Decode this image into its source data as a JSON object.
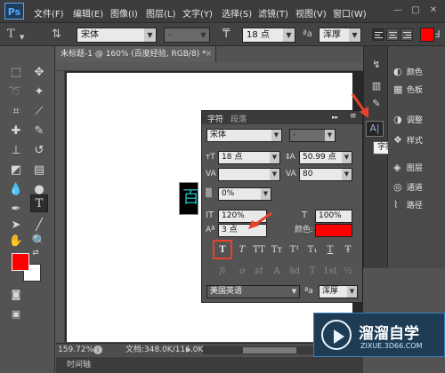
{
  "app": {
    "logo_text": "Ps",
    "menus": [
      "文件(F)",
      "编辑(E)",
      "图像(I)",
      "图层(L)",
      "文字(Y)",
      "选择(S)",
      "滤镜(T)",
      "视图(V)",
      "窗口(W)"
    ],
    "window_controls": [
      "—",
      "□",
      "✕"
    ]
  },
  "options_bar": {
    "font_family": "宋体",
    "font_style": "-",
    "font_size": "18 点",
    "anti_alias_label": "ªa",
    "anti_alias": "浑厚"
  },
  "document": {
    "tab_title": "未标题-1 @ 160% (百度经验, RGB/8) *",
    "zoom": "159.72%",
    "doc_info": "文档:348.0K/116.0K",
    "timeline": "时间轴",
    "text_glyph": "百"
  },
  "char_panel": {
    "tabs": [
      "字符",
      "段落"
    ],
    "font_family": "宋体",
    "font_style": "-",
    "font_size": "18 点",
    "leading": "50.99 点",
    "kerning": "",
    "tracking": "80",
    "tsume": "0%",
    "vertical_scale": "120%",
    "horizontal_scale": "100%",
    "baseline_shift": "3 点",
    "color_label": "颜色:",
    "color_value": "#ff0000",
    "format_buttons": [
      "T",
      "T",
      "TT",
      "Tт",
      "T¹",
      "T₁",
      "T",
      "Ŧ"
    ],
    "opentype_buttons": [
      "fi",
      "ơ",
      "st",
      "A",
      "ād",
      "T",
      "1st",
      "½"
    ],
    "language": "美国英语",
    "anti_alias_label": "ªa",
    "anti_alias": "浑厚"
  },
  "dock": {
    "items": [
      {
        "icon": "◐",
        "label": "颜色"
      },
      {
        "icon": "▦",
        "label": "色板"
      },
      {
        "icon": "◑",
        "label": "调整"
      },
      {
        "icon": "❖",
        "label": "样式"
      },
      {
        "icon": "◈",
        "label": "图层"
      },
      {
        "icon": "◎",
        "label": "通道"
      },
      {
        "icon": "⌇",
        "label": "路径"
      }
    ],
    "char_button": "A|",
    "tooltip": "字符"
  },
  "colors": {
    "foreground": "#ff0000",
    "background": "#ffffff",
    "accent_red": "#e8412c"
  },
  "watermark": {
    "title": "溜溜自学",
    "subtitle": "ZIXUE.3D66.COM"
  }
}
